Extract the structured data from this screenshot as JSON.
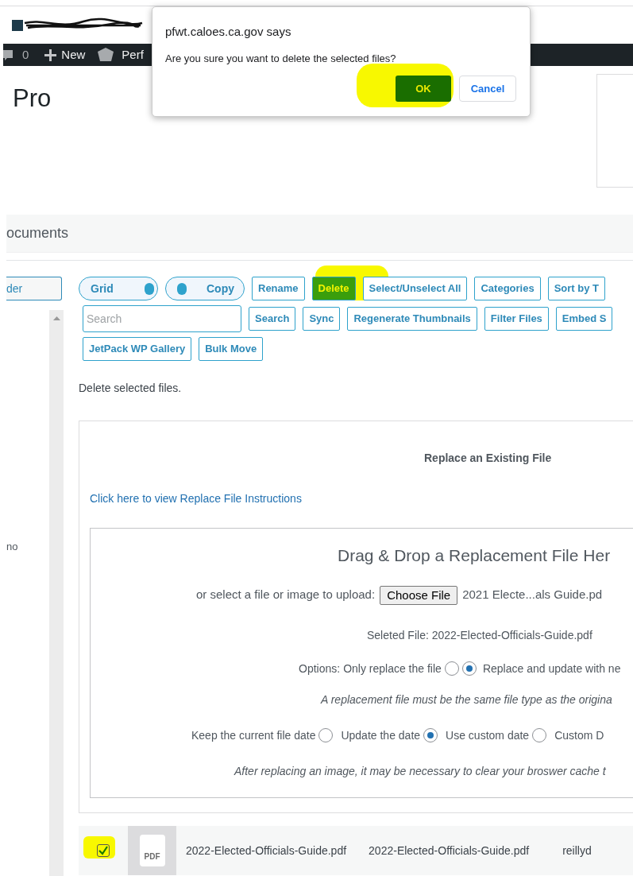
{
  "admin_bar": {
    "comments": "0",
    "new": "New",
    "perf": "Perf"
  },
  "page_title": "Pro",
  "section_title": "ocuments",
  "sidebar": {
    "folder_button": "der",
    "item": "no"
  },
  "toolbar": [
    [
      {
        "kind": "toggle",
        "label": "Grid",
        "on": true
      },
      {
        "kind": "toggle",
        "label": "Copy",
        "on": false
      },
      {
        "kind": "button",
        "label": "Rename",
        "highlighted": false
      },
      {
        "kind": "button",
        "label": "Delete",
        "highlighted": true
      },
      {
        "kind": "button",
        "label": "Select/Unselect All",
        "highlighted": false
      },
      {
        "kind": "button",
        "label": "Categories",
        "highlighted": false
      },
      {
        "kind": "button",
        "label": "Sort by T",
        "highlighted": false
      }
    ],
    [
      {
        "kind": "search",
        "placeholder": "Search"
      },
      {
        "kind": "button",
        "label": "Search",
        "highlighted": false
      },
      {
        "kind": "button",
        "label": "Sync",
        "highlighted": false
      },
      {
        "kind": "button",
        "label": "Regenerate Thumbnails",
        "highlighted": false
      },
      {
        "kind": "button",
        "label": "Filter Files",
        "highlighted": false
      },
      {
        "kind": "button",
        "label": "Embed S",
        "highlighted": false
      }
    ],
    [
      {
        "kind": "button",
        "label": "JetPack WP Gallery",
        "highlighted": false
      },
      {
        "kind": "button",
        "label": "Bulk Move",
        "highlighted": false
      }
    ]
  ],
  "status_message": "Delete selected files.",
  "replace_panel": {
    "title": "Replace an Existing File",
    "instructions_link": "Click here to view Replace File Instructions",
    "drop_title": "Drag & Drop a Replacement File Her",
    "upload_label": "or select a file or image to upload:",
    "choose_button": "Choose File",
    "chosen_file": "2021 Electe...als Guide.pd",
    "selected_file": "Seleted File: 2022-Elected-Officials-Guide.pdf",
    "options_label": "Options:",
    "replace_options": [
      {
        "label": "Only replace the file",
        "selected": false
      },
      {
        "label": "Replace and update with ne",
        "selected": true
      }
    ],
    "type_note": "A replacement file must be the same file type as the origina",
    "date_options": [
      {
        "label": "Keep the current file date",
        "selected": false
      },
      {
        "label": "Update the date",
        "selected": true
      },
      {
        "label": "Use custom date",
        "selected": false
      }
    ],
    "custom_date_label": "Custom D",
    "cache_note": "After replacing an image, it may be necessary to clear your broswer cache t"
  },
  "file_row": {
    "checked": true,
    "thumb_label": "PDF",
    "title": "2022-Elected-Officials-Guide.pdf",
    "filename": "2022-Elected-Officials-Guide.pdf",
    "owner": "reillyd"
  },
  "dialog": {
    "title": "pfwt.caloes.ca.gov says",
    "message": "Are you sure you want to delete the selected files?",
    "buttons": [
      {
        "label": "OK",
        "primary": true
      },
      {
        "label": "Cancel",
        "primary": false
      }
    ]
  }
}
